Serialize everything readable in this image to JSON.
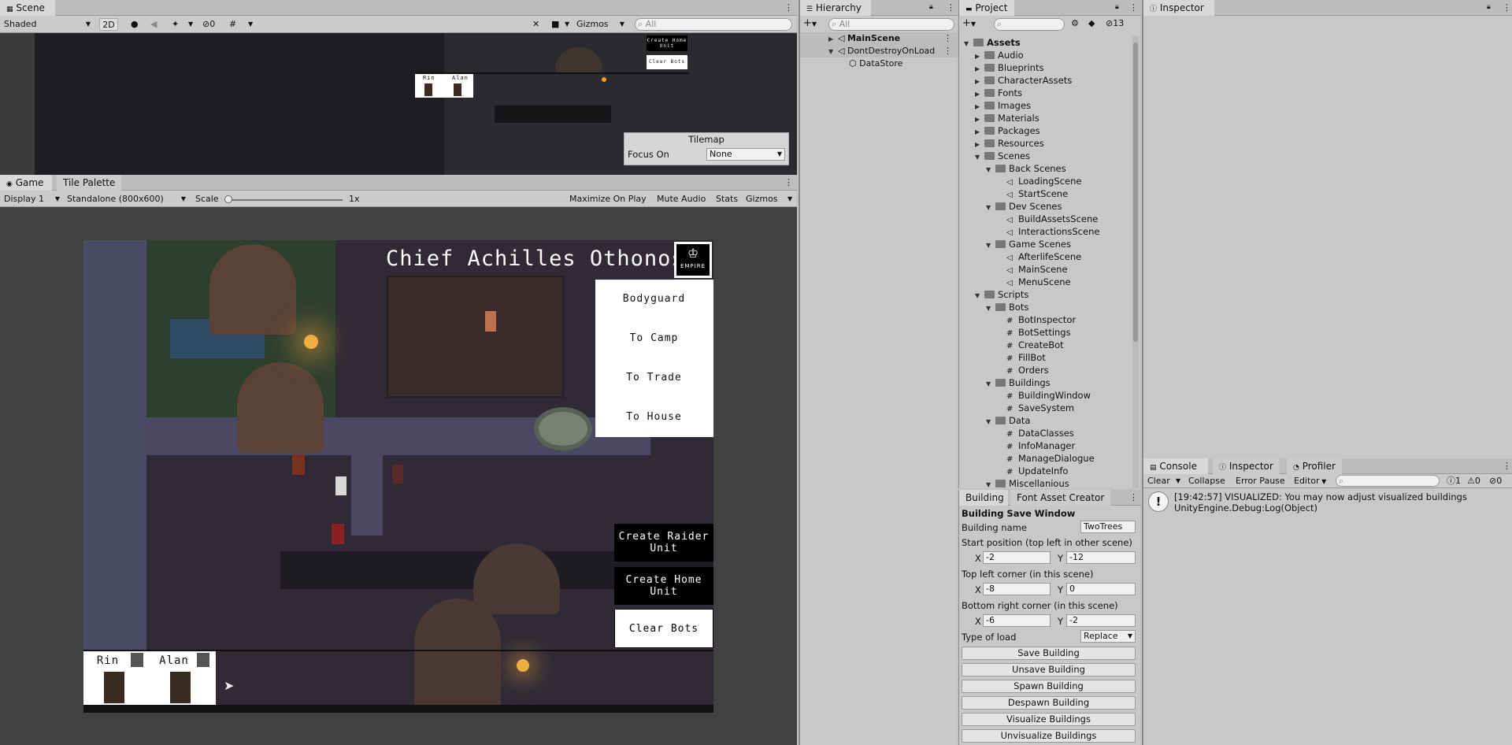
{
  "scene": {
    "tab": "Scene",
    "shading": "Shaded",
    "mode_2d": "2D",
    "hidden_count": "0",
    "gizmos": "Gizmos",
    "search_placeholder": "All",
    "overlay_create_home": "Create Home Unit",
    "overlay_clear_bots": "Clear Bots",
    "overlay_names": [
      "Rin",
      "Alan"
    ],
    "tilemap_title": "Tilemap",
    "focus_label": "Focus On",
    "focus_value": "None"
  },
  "game": {
    "tabs": [
      "Game",
      "Tile Palette"
    ],
    "display": "Display 1",
    "resolution": "Standalone (800x600)",
    "scale_label": "Scale",
    "scale_value": "1x",
    "toggles": [
      "Maximize On Play",
      "Mute Audio",
      "Stats",
      "Gizmos"
    ],
    "title": "Chief Achilles Othonos I",
    "badge": "EMPIRE",
    "menu": [
      "Bodyguard",
      "To Camp",
      "To Trade",
      "To House"
    ],
    "buttons": [
      "Create Raider Unit",
      "Create Home Unit",
      "Clear Bots"
    ],
    "units": [
      "Rin",
      "Alan"
    ]
  },
  "hierarchy": {
    "tab": "Hierarchy",
    "search_placeholder": "All",
    "items": [
      {
        "label": "MainScene",
        "bold": true
      },
      {
        "label": "DontDestroyOnLoad",
        "bold": false
      },
      {
        "label": "DataStore",
        "bold": false
      }
    ]
  },
  "project": {
    "tab": "Project",
    "badge_count": "13",
    "tree": [
      {
        "label": "Assets",
        "depth": 0,
        "kind": "folder",
        "open": true,
        "bold": true
      },
      {
        "label": "Audio",
        "depth": 1,
        "kind": "folder",
        "open": false
      },
      {
        "label": "Blueprints",
        "depth": 1,
        "kind": "folder",
        "open": false
      },
      {
        "label": "CharacterAssets",
        "depth": 1,
        "kind": "folder",
        "open": false
      },
      {
        "label": "Fonts",
        "depth": 1,
        "kind": "folder",
        "open": false
      },
      {
        "label": "Images",
        "depth": 1,
        "kind": "folder",
        "open": false
      },
      {
        "label": "Materials",
        "depth": 1,
        "kind": "folder",
        "open": false
      },
      {
        "label": "Packages",
        "depth": 1,
        "kind": "folder",
        "open": false
      },
      {
        "label": "Resources",
        "depth": 1,
        "kind": "folder",
        "open": false
      },
      {
        "label": "Scenes",
        "depth": 1,
        "kind": "folder",
        "open": true
      },
      {
        "label": "Back Scenes",
        "depth": 2,
        "kind": "folder",
        "open": true
      },
      {
        "label": "LoadingScene",
        "depth": 3,
        "kind": "scene"
      },
      {
        "label": "StartScene",
        "depth": 3,
        "kind": "scene"
      },
      {
        "label": "Dev Scenes",
        "depth": 2,
        "kind": "folder",
        "open": true
      },
      {
        "label": "BuildAssetsScene",
        "depth": 3,
        "kind": "scene"
      },
      {
        "label": "InteractionsScene",
        "depth": 3,
        "kind": "scene"
      },
      {
        "label": "Game Scenes",
        "depth": 2,
        "kind": "folder",
        "open": true
      },
      {
        "label": "AfterlifeScene",
        "depth": 3,
        "kind": "scene"
      },
      {
        "label": "MainScene",
        "depth": 3,
        "kind": "scene"
      },
      {
        "label": "MenuScene",
        "depth": 3,
        "kind": "scene"
      },
      {
        "label": "Scripts",
        "depth": 1,
        "kind": "folder",
        "open": true
      },
      {
        "label": "Bots",
        "depth": 2,
        "kind": "folder",
        "open": true
      },
      {
        "label": "BotInspector",
        "depth": 3,
        "kind": "script"
      },
      {
        "label": "BotSettings",
        "depth": 3,
        "kind": "script"
      },
      {
        "label": "CreateBot",
        "depth": 3,
        "kind": "script"
      },
      {
        "label": "FillBot",
        "depth": 3,
        "kind": "script"
      },
      {
        "label": "Orders",
        "depth": 3,
        "kind": "script"
      },
      {
        "label": "Buildings",
        "depth": 2,
        "kind": "folder",
        "open": true
      },
      {
        "label": "BuildingWindow",
        "depth": 3,
        "kind": "script"
      },
      {
        "label": "SaveSystem",
        "depth": 3,
        "kind": "script"
      },
      {
        "label": "Data",
        "depth": 2,
        "kind": "folder",
        "open": true
      },
      {
        "label": "DataClasses",
        "depth": 3,
        "kind": "script"
      },
      {
        "label": "InfoManager",
        "depth": 3,
        "kind": "script"
      },
      {
        "label": "ManageDialogue",
        "depth": 3,
        "kind": "script"
      },
      {
        "label": "UpdateInfo",
        "depth": 3,
        "kind": "script"
      },
      {
        "label": "Miscellanious",
        "depth": 2,
        "kind": "folder",
        "open": true
      }
    ]
  },
  "building": {
    "tabs": [
      "Building",
      "Font Asset Creator"
    ],
    "title": "Building Save Window",
    "name_label": "Building name",
    "name_value": "TwoTrees",
    "start_label": "Start position (top left in other scene)",
    "start_x": "-2",
    "start_y": "-12",
    "topleft_label": "Top left corner (in this scene)",
    "topleft_x": "-8",
    "topleft_y": "0",
    "bottomright_label": "Bottom right corner (in this scene)",
    "bottomright_x": "-6",
    "bottomright_y": "-2",
    "load_label": "Type of load",
    "load_value": "Replace",
    "x_label": "X",
    "y_label": "Y",
    "buttons": [
      "Save Building",
      "Unsave Building",
      "Spawn Building",
      "Despawn Building",
      "Visualize Buildings",
      "Unvisualize Buildings"
    ]
  },
  "inspector": {
    "tab": "Inspector"
  },
  "console": {
    "tabs": [
      "Console",
      "Inspector",
      "Profiler"
    ],
    "clear": "Clear",
    "collapse": "Collapse",
    "error_pause": "Error Pause",
    "editor": "Editor",
    "counts": [
      "1",
      "0",
      "0"
    ],
    "log_line1": "[19:42:57] VISUALIZED: You may now adjust visualized buildings",
    "log_line2": "UnityEngine.Debug:Log(Object)"
  }
}
